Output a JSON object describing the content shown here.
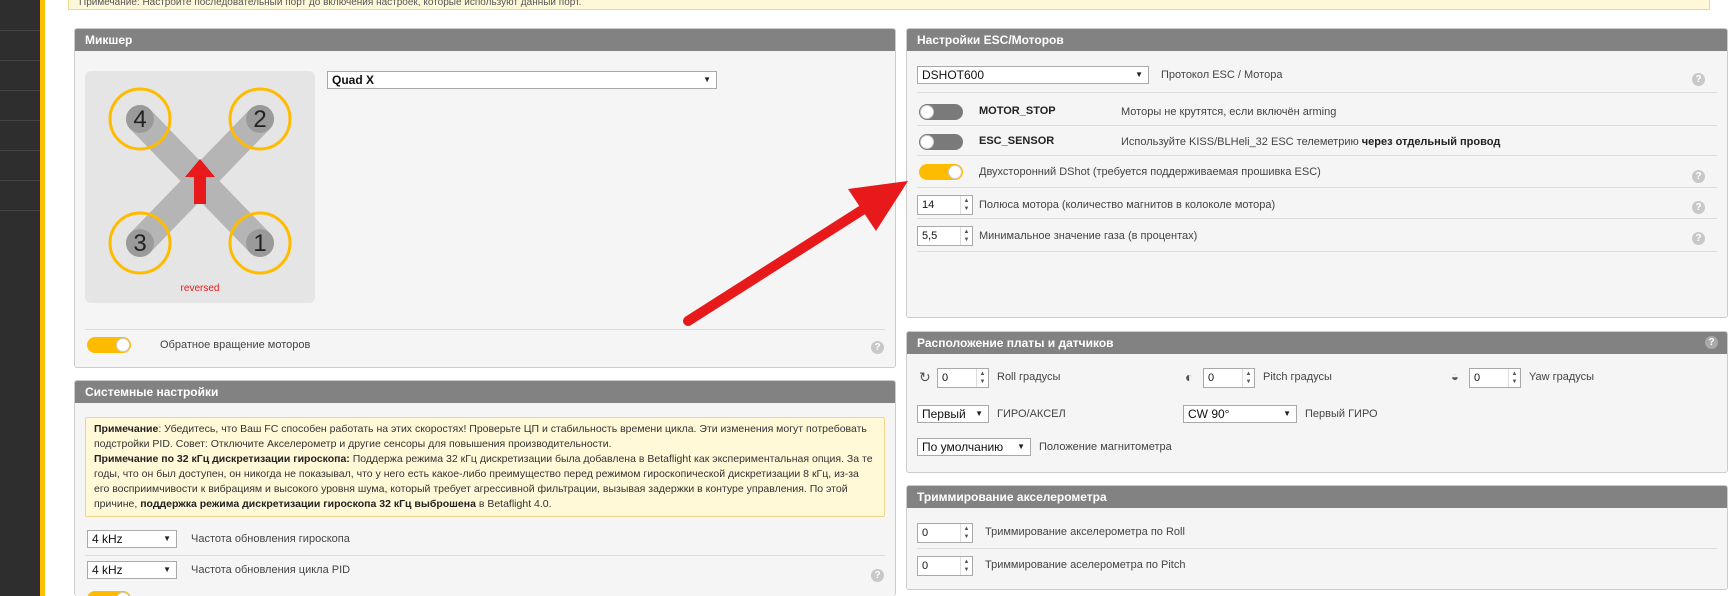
{
  "top_note": {
    "text": "Примечание: Настройте последовательный порт до включения настроек, которые используют данный порт."
  },
  "mixer": {
    "title": "Микшер",
    "preset": "Quad X",
    "motors": [
      "4",
      "2",
      "3",
      "1"
    ],
    "reversed_label": "reversed",
    "reverse_toggle_label": "Обратное вращение моторов",
    "reverse_enabled": true
  },
  "system": {
    "title": "Системные настройки",
    "note": {
      "p1_bold": "Примечание",
      "p1_text": ": Убедитесь, что Ваш FC способен работать на этих скоростях! Проверьте ЦП и стабильность времени цикла. Эти изменения могут потребовать подстройки PID. Совет: Отключите Акселерометр и другие сенсоры для повышения производительности.",
      "p2_bold": "Примечание по 32 кГц дискретизации гироскопа:",
      "p2_text": " Поддержа режима 32 кГц дискретизации была добавлена в Betaflight как экспериментальная опция. За те годы, что он был доступен, он никогда не показывал, что у него есть какое-либо преимущество перед режимом гироскопической дискретизации 8 кГц, из-за его восприимчивости к вибрациям и высокого уровня шума, который требует агрессивной фильтрации, вызывая задержки в контуре управления. По этой причине, ",
      "p2_bold2": "поддержка режима дискретизации гироскопа 32 кГц выброшена",
      "p2_tail": " в Betaflight 4.0."
    },
    "gyro_rate": "4 kHz",
    "gyro_rate_label": "Частота обновления гироскопа",
    "pid_rate": "4 kHz",
    "pid_rate_label": "Частота обновления цикла PID"
  },
  "esc": {
    "title": "Настройки ESC/Моторов",
    "protocol": "DSHOT600",
    "protocol_label": "Протокол ESC / Мотора",
    "motor_stop_name": "MOTOR_STOP",
    "motor_stop_desc": "Моторы не крутятся, если включён arming",
    "motor_stop_enabled": false,
    "esc_sensor_name": "ESC_SENSOR",
    "esc_sensor_desc": "Используйте KISS/BLHeli_32 ESC телеметрию ",
    "esc_sensor_desc_bold": "через отдельный провод",
    "esc_sensor_enabled": false,
    "bidir_label": "Двухсторонний DShot (требуется поддерживаемая прошивка ESC)",
    "bidir_enabled": true,
    "poles": "14",
    "poles_label": "Полюса мотора (количество магнитов в колоколе мотора)",
    "min_throttle": "5,5",
    "min_throttle_label": "Минимальное значение газа (в процентах)"
  },
  "board": {
    "title": "Расположение платы и датчиков",
    "roll": "0",
    "roll_label": "Roll градусы",
    "pitch": "0",
    "pitch_label": "Pitch градусы",
    "yaw": "0",
    "yaw_label": "Yaw градусы",
    "gyro_select": "Первый",
    "gyro_select_label": "ГИРО/АКСЕЛ",
    "gyro_align": "CW 90°",
    "gyro_align_label": "Первый ГИРО",
    "mag_align": "По умолчанию",
    "mag_align_label": "Положение магнитометра"
  },
  "trim": {
    "title": "Триммирование акселерометра",
    "roll": "0",
    "roll_label": "Триммирование акселерометра по Roll",
    "pitch": "0",
    "pitch_label": "Триммирование аселерометра по Pitch"
  },
  "help_glyph": "?",
  "colors": {
    "accent": "#ffbb00",
    "arrow": "#e8191a",
    "header": "#828282"
  }
}
